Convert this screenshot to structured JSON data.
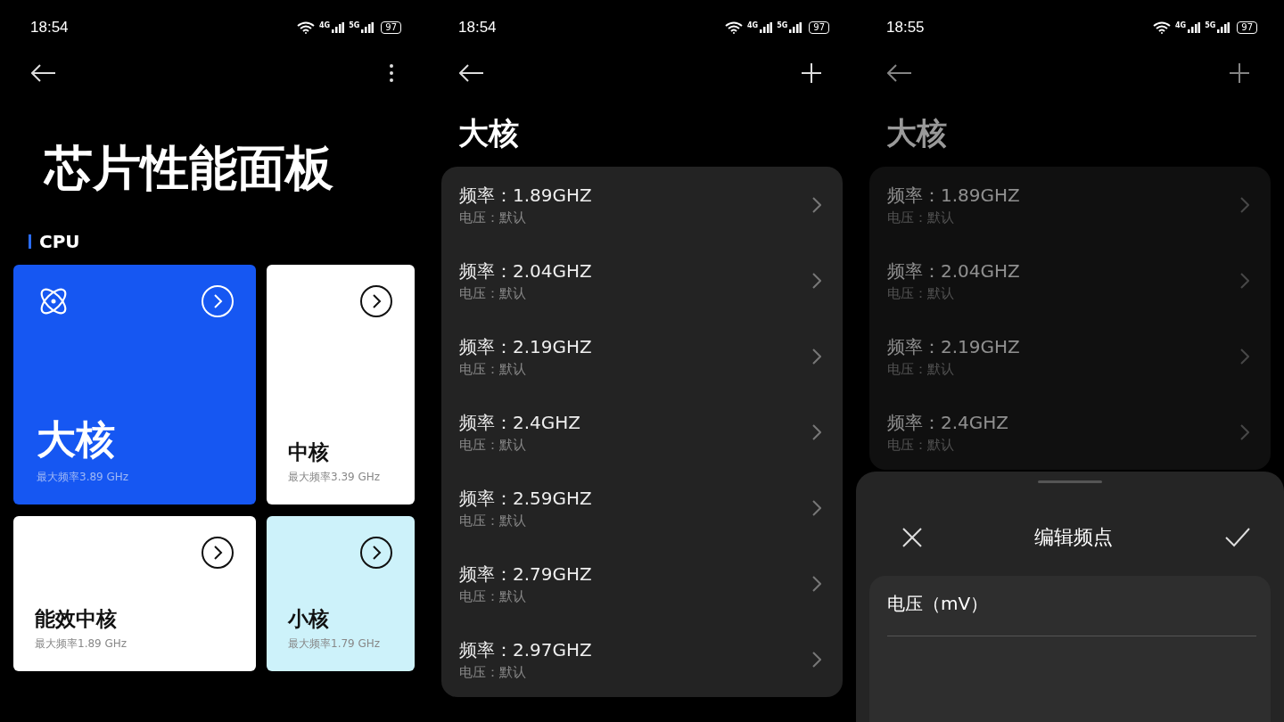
{
  "screens": [
    {
      "kind": "home",
      "dimmed": false,
      "status": {
        "time": "18:54",
        "network_1": "4G",
        "network_2": "5G",
        "battery": "97"
      },
      "title": "芯片性能面板",
      "section": "CPU",
      "cards": [
        {
          "name": "大核",
          "subtitle": "最大频率3.89 GHz",
          "featured": true,
          "color": "#1657f2"
        },
        {
          "name": "中核",
          "subtitle": "最大频率3.39 GHz",
          "featured": false,
          "color": "#ffffff"
        },
        {
          "name": "能效中核",
          "subtitle": "最大频率1.89 GHz",
          "featured": false,
          "color": "#ffffff"
        },
        {
          "name": "小核",
          "subtitle": "最大频率1.79 GHz",
          "featured": false,
          "color": "#cdf2fa"
        }
      ]
    },
    {
      "kind": "list",
      "dimmed": false,
      "status": {
        "time": "18:54",
        "network_1": "4G",
        "network_2": "5G",
        "battery": "97"
      },
      "title": "大核",
      "items": [
        {
          "frequency": "频率：1.89GHZ",
          "voltage": "电压：默认"
        },
        {
          "frequency": "频率：2.04GHZ",
          "voltage": "电压：默认"
        },
        {
          "frequency": "频率：2.19GHZ",
          "voltage": "电压：默认"
        },
        {
          "frequency": "频率：2.4GHZ",
          "voltage": "电压：默认"
        },
        {
          "frequency": "频率：2.59GHZ",
          "voltage": "电压：默认"
        },
        {
          "frequency": "频率：2.79GHZ",
          "voltage": "电压：默认"
        },
        {
          "frequency": "频率：2.97GHZ",
          "voltage": "电压：默认"
        }
      ]
    },
    {
      "kind": "list",
      "dimmed": true,
      "status": {
        "time": "18:55",
        "network_1": "4G",
        "network_2": "5G",
        "battery": "97"
      },
      "title": "大核",
      "items": [
        {
          "frequency": "频率：1.89GHZ",
          "voltage": "电压：默认"
        },
        {
          "frequency": "频率：2.04GHZ",
          "voltage": "电压：默认"
        },
        {
          "frequency": "频率：2.19GHZ",
          "voltage": "电压：默认"
        },
        {
          "frequency": "频率：2.4GHZ",
          "voltage": "电压：默认"
        }
      ],
      "sheet": {
        "title": "编辑频点",
        "field_label": "电压（mV）"
      }
    }
  ]
}
